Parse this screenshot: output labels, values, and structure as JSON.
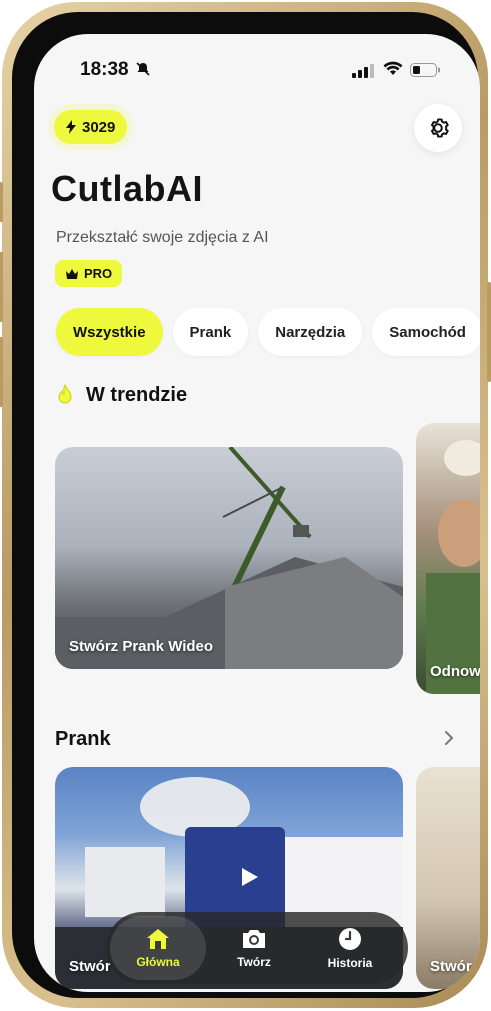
{
  "status_bar": {
    "time": "18:38"
  },
  "header": {
    "credits": "3029",
    "app_title": "CutlabAI",
    "subtitle": "Przekształć swoje zdjęcia z AI",
    "badge": "PRO"
  },
  "filters": [
    "Wszystkie",
    "Prank",
    "Narzędzia",
    "Samochód"
  ],
  "sections": {
    "trending": {
      "title": "W trendzie",
      "cards": [
        "Stwórz Prank Wideo",
        "Odnow"
      ]
    },
    "prank": {
      "title": "Prank",
      "cards": [
        "Stwór",
        "Stwór"
      ]
    }
  },
  "nav": {
    "items": [
      "Główna",
      "Twórz",
      "Historia"
    ],
    "active": "Główna"
  },
  "colors": {
    "accent": "#eef83c",
    "background": "#f6f6f7",
    "text": "#141414"
  }
}
